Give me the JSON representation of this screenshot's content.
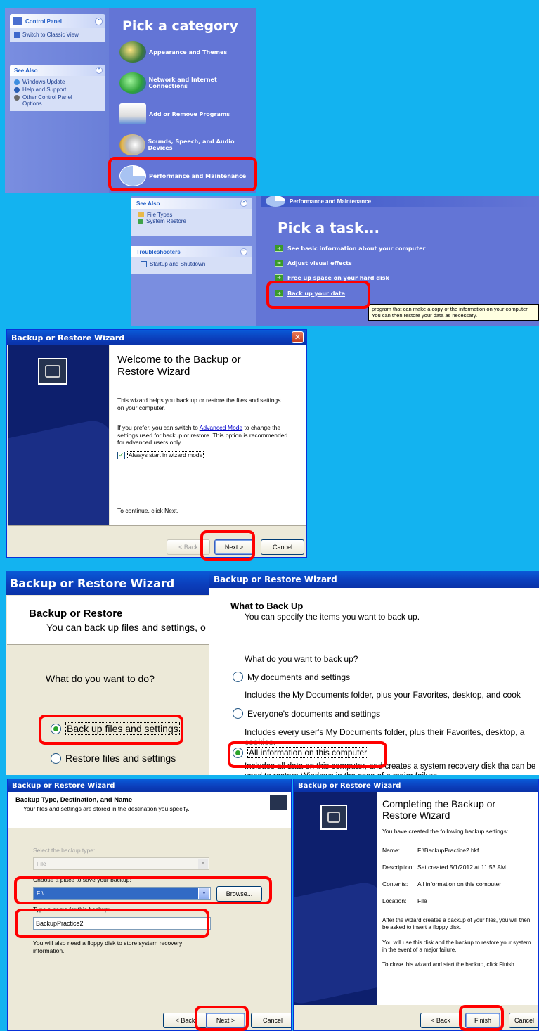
{
  "control_panel": {
    "title": "Control Panel",
    "switch_view": "Switch to Classic View",
    "see_also": "See Also",
    "links": [
      "Windows Update",
      "Help and Support",
      "Other Control Panel Options"
    ],
    "heading": "Pick a category",
    "categories": [
      "Appearance and Themes",
      "Network and Internet Connections",
      "Add or Remove Programs",
      "Sounds, Speech, and Audio Devices",
      "Performance and Maintenance"
    ]
  },
  "perf_panel": {
    "see_also": "See Also",
    "links": [
      "File Types",
      "System Restore"
    ],
    "troubleshooters": "Troubleshooters",
    "ts_links": [
      "Startup and Shutdown"
    ],
    "header": "Performance and Maintenance",
    "heading": "Pick a task...",
    "tasks": [
      "See basic information about your computer",
      "Adjust visual effects",
      "Free up space on your hard disk",
      "Back up your data"
    ],
    "tooltip": "program that can make a copy of the information on your computer. You can then restore your data as necessary."
  },
  "welcome": {
    "title": "Backup or Restore Wizard",
    "heading": "Welcome to the Backup or Restore Wizard",
    "p1": "This wizard helps you back up or restore the files and settings on your computer.",
    "p2_pre": "If you prefer, you can switch to",
    "p2_link": "Advanced Mode",
    "p2_post": "to change the settings used for backup or restore. This option is recommended for advanced users only.",
    "checkbox": "Always start in wizard mode",
    "continue": "To continue, click Next.",
    "btn_back": "< Back",
    "btn_next": "Next >",
    "btn_cancel": "Cancel"
  },
  "bor": {
    "title": "Backup or Restore Wizard",
    "heading": "Backup or Restore",
    "sub": "You can back up files and settings, o",
    "question": "What do you want to do?",
    "options": [
      "Back up files and settings",
      "Restore files and settings"
    ]
  },
  "what": {
    "title": "Backup or Restore Wizard",
    "heading": "What to Back Up",
    "sub": "You can specify the items you want to back up.",
    "question": "What do you want to back up?",
    "o1": "My documents and settings",
    "o1_desc": "Includes the My Documents folder, plus your Favorites, desktop, and cook",
    "o2": "Everyone's documents and settings",
    "o2_desc": "Includes every user's My Documents folder, plus their Favorites, desktop, a",
    "o2_desc2": "cookies.",
    "o3": "All information on this computer",
    "o3_desc": "Includes all data on this computer, and creates a system recovery disk tha can be used to restore Windows in the case of a major failure."
  },
  "dest": {
    "title": "Backup or Restore Wizard",
    "heading": "Backup Type, Destination, and Name",
    "sub": "Your files and settings are stored in the destination you specify.",
    "type_label": "Select the backup type:",
    "type_value": "File",
    "place_label": "Choose a place to save your backup:",
    "place_value": "F:\\",
    "browse": "Browse...",
    "name_label": "Type a name for this backup:",
    "name_value": "BackupPractice2",
    "note": "You will also need a floppy disk to store system recovery information.",
    "btn_back": "< Back",
    "btn_next": "Next >",
    "btn_cancel": "Cancel"
  },
  "complete": {
    "title": "Backup or Restore Wizard",
    "heading": "Completing the Backup or Restore Wizard",
    "intro": "You have created the following backup settings:",
    "rows": [
      {
        "k": "Name:",
        "v": "F:\\BackupPractice2.bkf"
      },
      {
        "k": "Description:",
        "v": "Set created 5/1/2012 at 11:53 AM"
      },
      {
        "k": "Contents:",
        "v": "All information on this computer"
      },
      {
        "k": "Location:",
        "v": "File"
      }
    ],
    "p1": "After the wizard creates a backup of your files, you will then be asked to insert a floppy disk.",
    "p2": "You will use this disk and the backup to restore your system in the event of a major failure.",
    "p3": "To close this wizard and start the backup, click Finish.",
    "btn_back": "< Back",
    "btn_finish": "Finish",
    "btn_cancel": "Cancel"
  }
}
